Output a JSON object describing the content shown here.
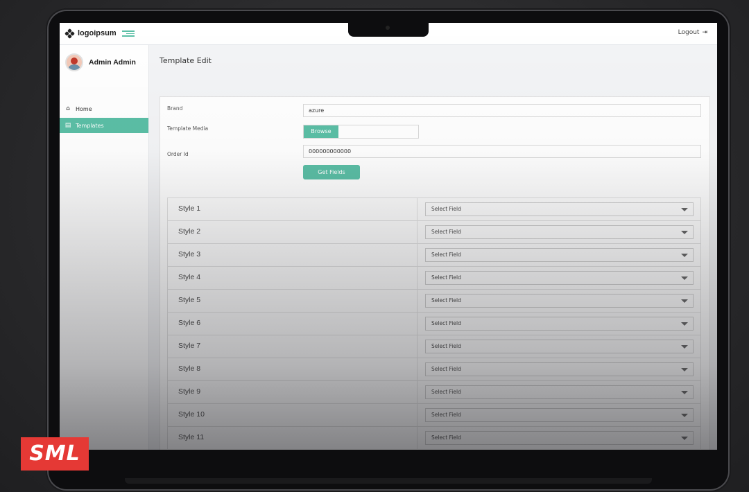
{
  "topbar": {
    "logo_text": "logoipsum",
    "logo_icon": "logo-mark",
    "menu_icon": "menu-collapse-icon",
    "logout_label": "Logout",
    "logout_icon": "logout-icon"
  },
  "sidebar": {
    "user_name": "Admin Admin",
    "items": [
      {
        "label": "Home",
        "icon": "home-icon"
      },
      {
        "label": "Templates",
        "icon": "file-icon",
        "active": true
      }
    ]
  },
  "page": {
    "title": "Template Edit"
  },
  "form": {
    "brand_label": "Brand",
    "brand_value": "azure",
    "media_label": "Template Media",
    "browse_label": "Browse",
    "order_label": "Order Id",
    "order_value": "000000000000",
    "get_fields_label": "Get Fields"
  },
  "styles": [
    {
      "label": "Style 1",
      "select": "Select Field"
    },
    {
      "label": "Style 2",
      "select": "Select Field"
    },
    {
      "label": "Style 3",
      "select": "Select Field"
    },
    {
      "label": "Style 4",
      "select": "Select Field"
    },
    {
      "label": "Style 5",
      "select": "Select Field"
    },
    {
      "label": "Style 6",
      "select": "Select Field"
    },
    {
      "label": "Style 7",
      "select": "Select Field"
    },
    {
      "label": "Style 8",
      "select": "Select Field"
    },
    {
      "label": "Style 9",
      "select": "Select Field"
    },
    {
      "label": "Style 10",
      "select": "Select Field"
    },
    {
      "label": "Style 11",
      "select": "Select Field"
    }
  ],
  "badge": {
    "text": "SML"
  },
  "colors": {
    "accent": "#5bbfa6",
    "badge": "#e53935"
  }
}
